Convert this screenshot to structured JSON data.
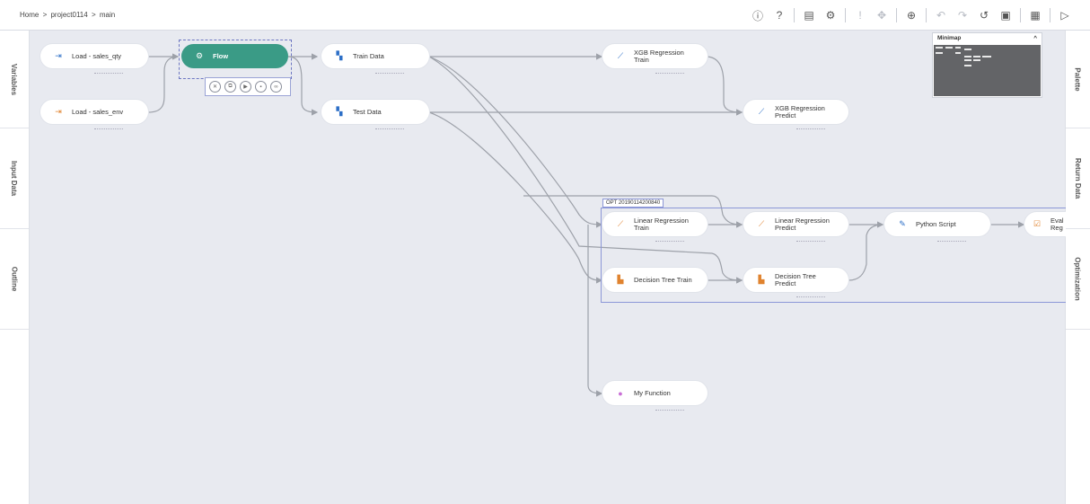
{
  "breadcrumb": {
    "home": "Home",
    "sep1": ">",
    "project": "project0114",
    "sep2": ">",
    "flow": "main"
  },
  "toolbar": {
    "icons": [
      "info-icon",
      "help-icon",
      "notebook-icon",
      "deploy-icon",
      "validate-icon",
      "move-icon",
      "zoom-icon",
      "undo-icon",
      "redo-icon",
      "history-icon",
      "clipboard-icon",
      "calendar-icon",
      "run-icon"
    ]
  },
  "left_tabs": [
    "Variables",
    "Input Data",
    "Outline"
  ],
  "right_tabs": [
    "Palette",
    "Return Data",
    "Optimization"
  ],
  "minimap": {
    "title": "Minimap",
    "collapse": "^"
  },
  "nodes": {
    "load_qty": "Load - sales_qty",
    "load_env": "Load - sales_env",
    "flow": "Flow",
    "train_data": "Train Data",
    "test_data": "Test Data",
    "xgb_train_1": "XGB Regression",
    "xgb_train_2": "Train",
    "xgb_predict_1": "XGB Regression",
    "xgb_predict_2": "Predict",
    "lr_train_1": "Linear Regression",
    "lr_train_2": "Train",
    "lr_predict_1": "Linear Regression",
    "lr_predict_2": "Predict",
    "python": "Python Script",
    "eval_1": "Eval",
    "eval_2": "Reg",
    "dt_train": "Decision Tree Train",
    "dt_predict_1": "Decision Tree",
    "dt_predict_2": "Predict",
    "my_function": "My Function"
  },
  "opt_group": {
    "label": "OPT 20190114200840"
  },
  "colors": {
    "accent": "#3a9b86",
    "edge": "#9da1a9",
    "group": "#8c97d7",
    "canvas": "#e8eaf0"
  }
}
